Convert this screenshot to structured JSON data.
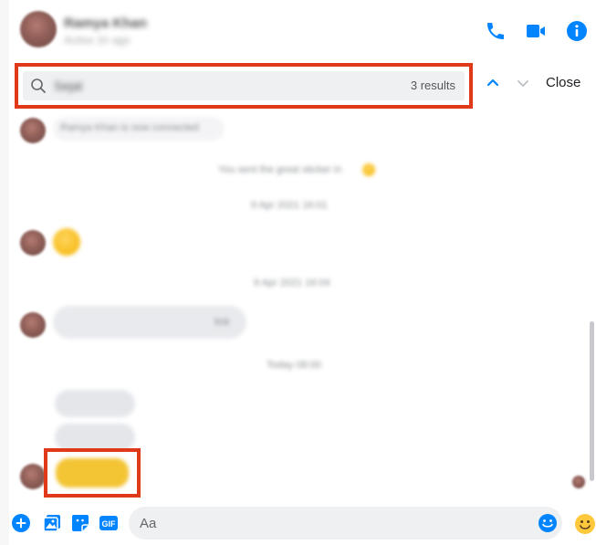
{
  "header": {
    "contact_name": "Ramya Khan",
    "contact_status": "Active 1h ago",
    "icons": [
      "phone-icon",
      "video-icon",
      "info-icon"
    ]
  },
  "search": {
    "query": "Sejal",
    "result_count": "3 results",
    "close_label": "Close"
  },
  "messages": {
    "blurred_message": "Ramya Khan is now connected",
    "system_1": "You sent the great sticker in",
    "time_1": "9 Apr 2021 16:01",
    "time_2": "9 Apr 2021 16:04",
    "time_3": "Today 08:00",
    "attachment_label": "link"
  },
  "composer": {
    "placeholder": "Aa",
    "icons": [
      "plus-icon",
      "image-icon",
      "sticker-icon",
      "gif-icon",
      "emoji-icon",
      "like-emoji-icon"
    ]
  },
  "colors": {
    "accent": "#0084ff",
    "highlight_frame": "#e0391a",
    "search_highlight": "#f3c433"
  }
}
